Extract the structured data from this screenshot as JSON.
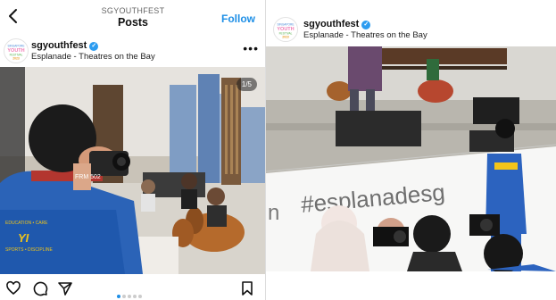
{
  "left": {
    "topbar": {
      "account_small": "SGYOUTHFEST",
      "title": "Posts",
      "follow_label": "Follow",
      "back_icon": "chevron-left-icon"
    },
    "post": {
      "username": "sgyouthfest",
      "location": "Esplanade - Theatres on the Bay",
      "more_icon": "more-horizontal-icon",
      "counter": "1/5",
      "shirt_text": [
        "FRM 502",
        "YI",
        "EDUCATION • CARE",
        "SPORTS • DISCIPLINE"
      ],
      "actions": [
        "heart-icon",
        "comment-icon",
        "share-icon"
      ],
      "save_icon": "bookmark-icon",
      "carousel_total": 5,
      "carousel_active": 1
    }
  },
  "right": {
    "post": {
      "username": "sgyouthfest",
      "location": "Esplanade - Theatres on the Bay",
      "hashtag": "#esplanadesg",
      "wall_fragment": "n"
    }
  },
  "logo": {
    "line1": "SINGAPORE",
    "line2": "YOUTH",
    "line3": "FESTIVAL",
    "line4": "2023"
  },
  "colors": {
    "accent": "#1e8fe6",
    "verified": "#2c9cf0"
  }
}
